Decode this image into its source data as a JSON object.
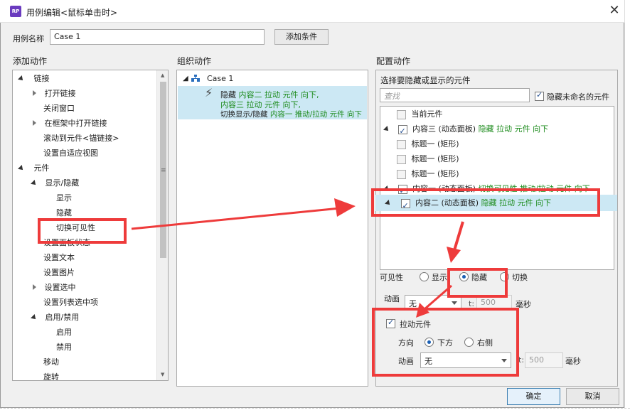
{
  "window": {
    "title": "用例编辑<鼠标单击时>"
  },
  "case_name": {
    "label": "用例名称",
    "value": "Case 1",
    "add_condition": "添加条件"
  },
  "left": {
    "header": "添加动作",
    "items": [
      {
        "text": "链接"
      },
      {
        "text": "打开链接"
      },
      {
        "text": "关闭窗口"
      },
      {
        "text": "在框架中打开链接"
      },
      {
        "text": "滚动到元件<锚链接>"
      },
      {
        "text": "设置自适应视图"
      },
      {
        "text": "元件"
      },
      {
        "text": "显示/隐藏"
      },
      {
        "text": "显示"
      },
      {
        "text": "隐藏"
      },
      {
        "text": "切换可见性"
      },
      {
        "text": "设置面板状态"
      },
      {
        "text": "设置文本"
      },
      {
        "text": "设置图片"
      },
      {
        "text": "设置选中"
      },
      {
        "text": "设置列表选中项"
      },
      {
        "text": "启用/禁用"
      },
      {
        "text": "启用"
      },
      {
        "text": "禁用"
      },
      {
        "text": "移动"
      },
      {
        "text": "旋转"
      }
    ]
  },
  "middle": {
    "header": "组织动作",
    "case_label": "Case 1",
    "action": {
      "line1_a": "隐藏 ",
      "line1_b": "内容二 拉动 元件 向下,",
      "line2": "内容三 拉动 元件 向下,",
      "line3_a": "切换显示/隐藏 ",
      "line3_b": "内容一 推动/拉动 元件 向下"
    }
  },
  "right": {
    "header": "配置动作",
    "subheader": "选择要隐藏或显示的元件",
    "search_placeholder": "查找",
    "hide_unnamed": "隐藏未命名的元件",
    "items": [
      {
        "name": "当前元件",
        "extra": ""
      },
      {
        "name": "内容三 (动态面板) ",
        "extra": "隐藏 拉动 元件 向下"
      },
      {
        "name": "标题一 (矩形)",
        "extra": ""
      },
      {
        "name": "标题一 (矩形)",
        "extra": ""
      },
      {
        "name": "标题一 (矩形)",
        "extra": ""
      },
      {
        "name": "内容一 (动态面板) ",
        "extra": "切换可见性 推动/拉动 元件 向下"
      },
      {
        "name": "内容二 (动态面板) ",
        "extra": "隐藏 拉动 元件 向下"
      }
    ],
    "visibility_label": "可见性",
    "opt_show": "显示",
    "opt_hide": "隐藏",
    "opt_toggle": "切换",
    "anim_label": "动画",
    "anim_value": "无",
    "t_label": "t:",
    "t_value": "500",
    "ms": "毫秒",
    "pull_label": "拉动元件",
    "dir_label": "方向",
    "dir_down": "下方",
    "dir_right": "右侧",
    "anim2_value": "无",
    "t2_label": "t:",
    "t2_value": "500",
    "ms2": "毫秒"
  },
  "footer": {
    "ok": "确定",
    "cancel": "取消"
  },
  "colors": {
    "annotation_red": "#ee3b3b",
    "selection": "#cce8f4",
    "green_text": "#1e8c1e"
  }
}
